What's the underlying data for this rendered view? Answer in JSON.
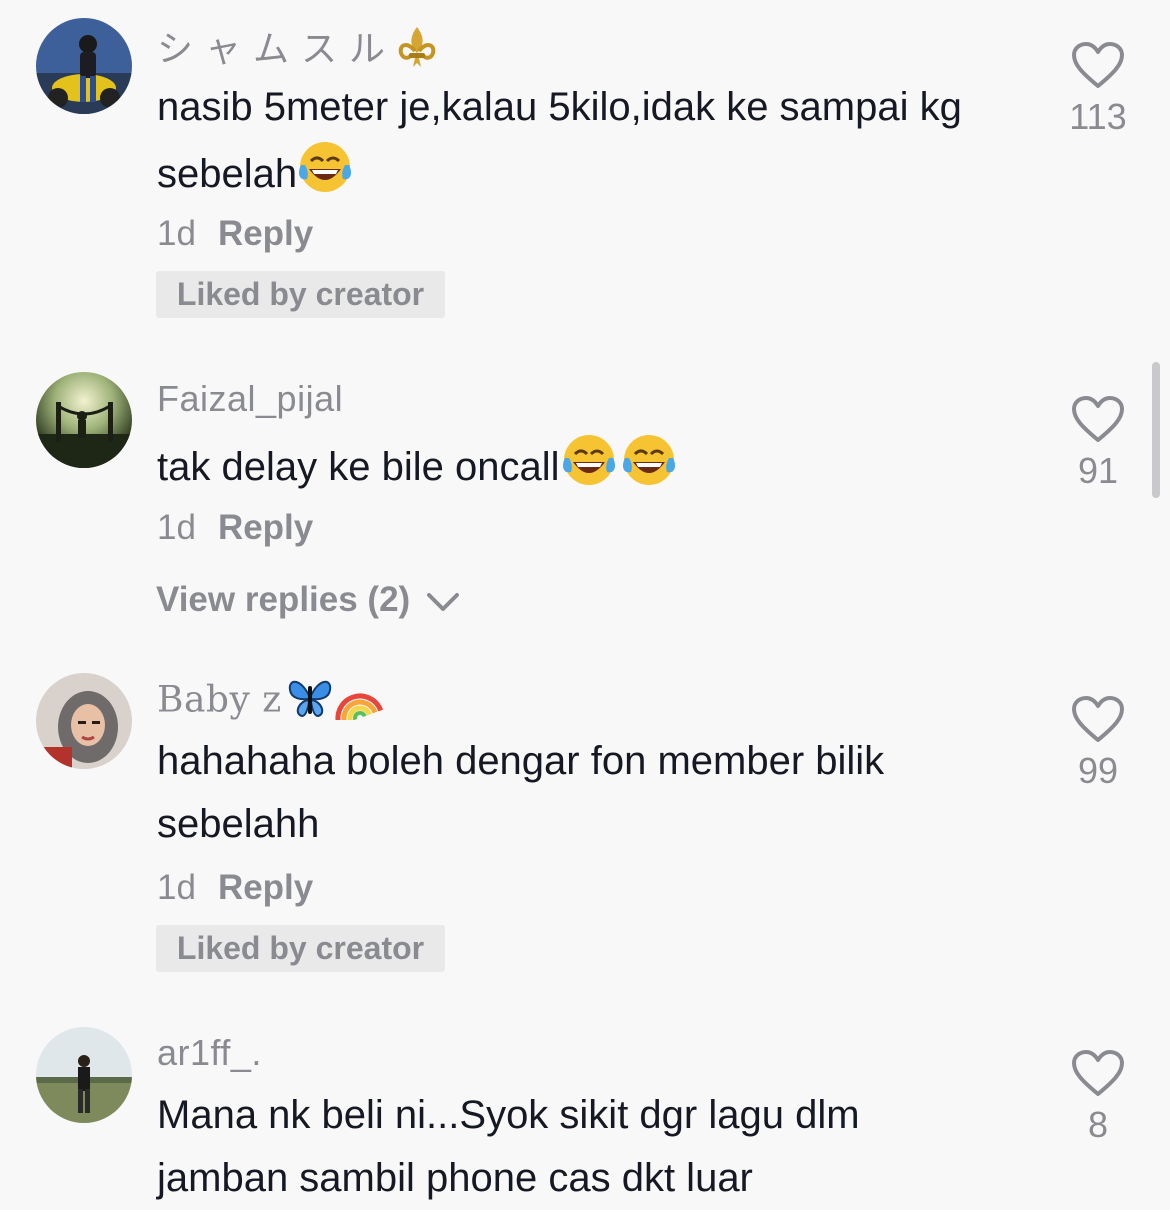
{
  "comments": [
    {
      "username": "シャムスル",
      "username_emoji": "fleur-de-lis-icon",
      "text": "nasib 5meter je,kalau 5kilo,idak ke sampai kg sebelah",
      "text_emoji": "laughing-tears-emoji",
      "time": "1d",
      "reply_label": "Reply",
      "liked_by_creator": "Liked by creator",
      "likes": "113"
    },
    {
      "username": "Faizal_pijal",
      "text": "tak delay ke bile oncall",
      "text_emoji": "laughing-tears-emoji x2",
      "time": "1d",
      "reply_label": "Reply",
      "view_replies": "View replies (2)",
      "likes": "91"
    },
    {
      "username": "Baby z",
      "username_emoji": "butterfly-and-rainbow-emoji",
      "text": "hahahaha boleh dengar fon member bilik sebelahh",
      "time": "1d",
      "reply_label": "Reply",
      "liked_by_creator": "Liked by creator",
      "likes": "99"
    },
    {
      "username": "ar1ff_.",
      "text": "Mana nk beli ni...Syok sikit dgr lagu dlm jamban sambil phone cas dkt luar",
      "likes": "8"
    }
  ],
  "colors": {
    "background": "#f8f8f8",
    "text": "#161823",
    "secondary": "#8a8b91",
    "chip": "#e9e9ea"
  }
}
